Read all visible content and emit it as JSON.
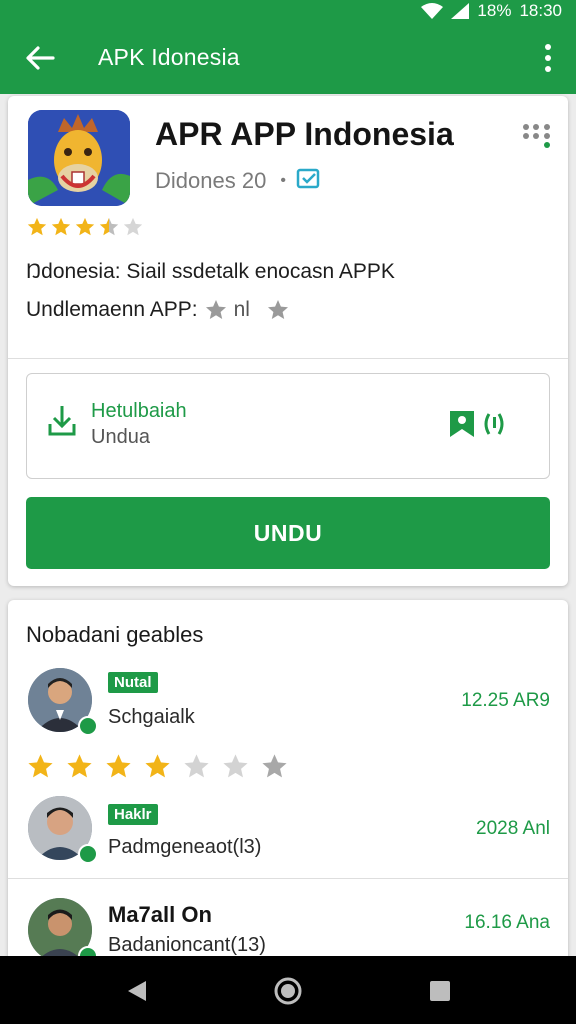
{
  "status_bar": {
    "battery": "18%",
    "time": "18:30"
  },
  "app_bar": {
    "title": "APK Idonesia"
  },
  "app": {
    "name": "APR APP Indonesia",
    "developer": "Didones 20",
    "separator": "•",
    "rating_value": 3.5,
    "rating_max": 5,
    "description_line1": "Ŋdonesia: Siail ssdetalk enocasn APPK",
    "description_line2": "Undlemaenn APP:",
    "description_line2_suffix": "nl"
  },
  "install": {
    "title": "Hetulbaiah",
    "subtitle": "Undua"
  },
  "download_button": {
    "label": "UNDU"
  },
  "reviews": {
    "title": "Nobadani geables",
    "items": [
      {
        "tag": "Nutal",
        "name": "Schgaialk",
        "time": "12.25 AR9",
        "rating": 4,
        "rating_max": 7
      },
      {
        "tag": "Haklr",
        "name": "Padmgeneaot(l3)",
        "time": "2028 Anl"
      },
      {
        "name": "Ma7all On",
        "subtitle": "Badanioncant(13)",
        "time": "16.16 Ana"
      }
    ]
  },
  "colors": {
    "brand_green": "#1e9a47",
    "star_gold": "#f2b418",
    "star_gray": "#bdbdbd"
  },
  "icons": [
    "back-arrow-icon",
    "overflow-menu-icon",
    "grid-dots-icon",
    "verified-icon",
    "download-icon",
    "bookmark-icon",
    "nav-back-icon",
    "nav-home-icon",
    "nav-recents-icon"
  ]
}
